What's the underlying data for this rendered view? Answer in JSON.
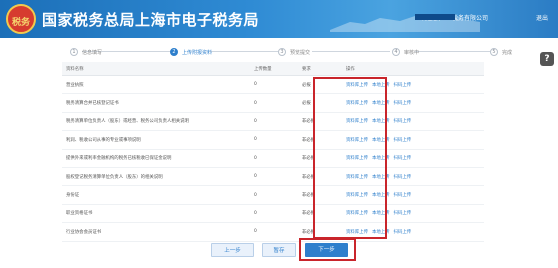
{
  "header": {
    "emblem_text": "税务",
    "title": "国家税务总局上海市电子税务局",
    "user_text": "欢迎您，上   税务有限公司",
    "logout_label": "退出"
  },
  "steps": [
    {
      "num": "1",
      "label": "信息填写"
    },
    {
      "num": "2",
      "label": "上传附报资料"
    },
    {
      "num": "3",
      "label": "预览提交"
    },
    {
      "num": "4",
      "label": "审核中"
    },
    {
      "num": "5",
      "label": "完成"
    }
  ],
  "table": {
    "headers": [
      "资料名称",
      "上传数量",
      "要求",
      "操作"
    ],
    "op_labels": [
      "资料库上传",
      "本地上传",
      "扫码上传"
    ],
    "rows": [
      {
        "name": "营业执照",
        "count": "0",
        "req": "必报"
      },
      {
        "name": "税务清算合并已核登记证书",
        "count": "0",
        "req": "必报"
      },
      {
        "name": "税务清算单位负责人（股东）或经营、税务公司负责人相关说明",
        "count": "0",
        "req": "非必报"
      },
      {
        "name": "利润、税收公司从事的专业或事项说明",
        "count": "0",
        "req": "非必报"
      },
      {
        "name": "提供外来或利率金融机构的税务已核税收已保证金说明",
        "count": "0",
        "req": "非必报"
      },
      {
        "name": "股权登记税务清算单位负责人（股东）的相关说明",
        "count": "0",
        "req": "非必报"
      },
      {
        "name": "身份证",
        "count": "0",
        "req": "非必报"
      },
      {
        "name": "职业资格证书",
        "count": "0",
        "req": "非必报"
      },
      {
        "name": "行业协会会员证书",
        "count": "0",
        "req": "非必报"
      }
    ]
  },
  "buttons": {
    "prev": "上一步",
    "save": "暂存",
    "next": "下一步"
  },
  "help_label": "?"
}
